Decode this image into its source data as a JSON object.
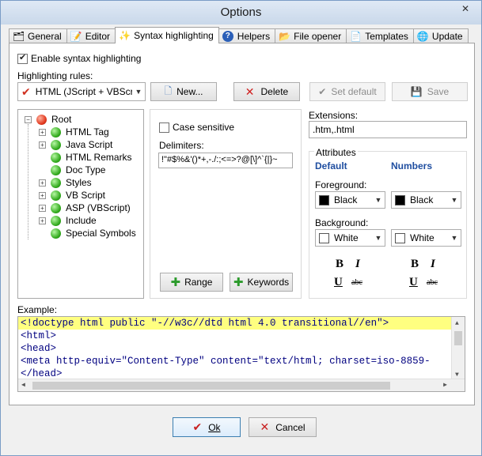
{
  "window": {
    "title": "Options",
    "close_glyph": "✕"
  },
  "tabs": [
    {
      "label": "General",
      "icon": "general-icon",
      "glyph": "🗂"
    },
    {
      "label": "Editor",
      "icon": "editor-icon",
      "glyph": "📝"
    },
    {
      "label": "Syntax highlighting",
      "icon": "wand-icon",
      "glyph": "✨",
      "active": true
    },
    {
      "label": "Helpers",
      "icon": "help-icon",
      "glyph": "?"
    },
    {
      "label": "File opener",
      "icon": "folder-icon",
      "glyph": "📂"
    },
    {
      "label": "Templates",
      "icon": "template-icon",
      "glyph": "📄"
    },
    {
      "label": "Update",
      "icon": "globe-icon",
      "glyph": "🌐"
    }
  ],
  "syntax": {
    "enable_label": "Enable syntax highlighting",
    "enable_checked": true,
    "rules_label": "Highlighting rules:",
    "rules_selected": "HTML (JScript + VBScript)",
    "new_label": "New...",
    "delete_label": "Delete",
    "set_default_label": "Set default",
    "save_label": "Save"
  },
  "tree": {
    "root": "Root",
    "items": [
      {
        "label": "HTML Tag",
        "expandable": true
      },
      {
        "label": "Java Script",
        "expandable": true
      },
      {
        "label": "HTML Remarks",
        "expandable": false
      },
      {
        "label": "Doc Type",
        "expandable": false
      },
      {
        "label": "Styles",
        "expandable": true
      },
      {
        "label": "VB Script",
        "expandable": true
      },
      {
        "label": "ASP (VBScript)",
        "expandable": true
      },
      {
        "label": "Include",
        "expandable": true
      },
      {
        "label": "Special Symbols",
        "expandable": false
      }
    ]
  },
  "rule": {
    "case_sensitive_label": "Case sensitive",
    "case_sensitive_checked": false,
    "delimiters_label": "Delimiters:",
    "delimiters_value": "!\"#$%&'()*+,-./:;<=>?@[\\]^`{|}~",
    "range_label": "Range",
    "keywords_label": "Keywords"
  },
  "extensions": {
    "label": "Extensions:",
    "value": ".htm,.html"
  },
  "attributes": {
    "legend": "Attributes",
    "col1": "Default",
    "col2": "Numbers",
    "foreground_label": "Foreground:",
    "background_label": "Background:",
    "fg_default": "Black",
    "fg_numbers": "Black",
    "bg_default": "White",
    "bg_numbers": "White",
    "bold": "B",
    "italic": "I",
    "underline": "U",
    "strike": "abc"
  },
  "example": {
    "label": "Example:",
    "lines": [
      "<!doctype html public \"-//w3c//dtd html 4.0 transitional//en\">",
      "<html>",
      "<head>",
      "<meta http-equiv=\"Content-Type\" content=\"text/html; charset=iso-8859-",
      "</head>"
    ]
  },
  "footer": {
    "ok_label": "Ok",
    "cancel_label": "Cancel"
  },
  "colors": {
    "accent": "#1f4ea0",
    "highlight_line": "#ffff80"
  }
}
